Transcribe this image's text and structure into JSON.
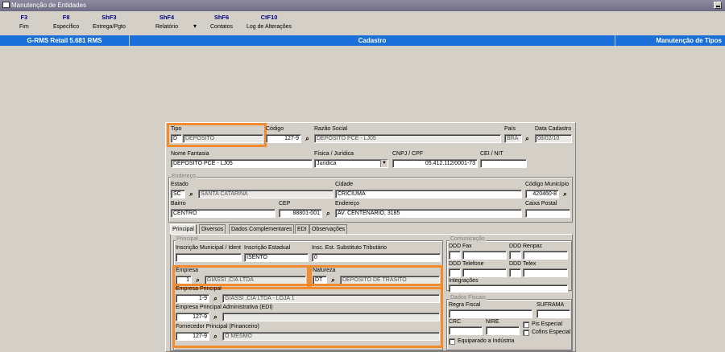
{
  "window": {
    "title": "Manutenção de Entidades"
  },
  "fkeys": [
    {
      "key": "F3",
      "label": "Fim"
    },
    {
      "key": "F8",
      "label": "Específico"
    },
    {
      "key": "ShF3",
      "label": "Entrega/Pgto"
    },
    {
      "key": "ShF4",
      "label": "Relatório"
    },
    {
      "key": "ShF6",
      "label": "Contatos"
    },
    {
      "key": "CtF10",
      "label": "Log de Alterações"
    }
  ],
  "fkey_more": "▾",
  "header": {
    "left": "G-RMS Retail 5.681 RMS",
    "center": "Cadastro",
    "right": "Manutenção de Tipos"
  },
  "top": {
    "tipo_label": "Tipo",
    "tipo_code": "D",
    "tipo_desc": "DEPOSITO",
    "codigo_label": "Código",
    "codigo_value": "127-9",
    "razao_label": "Razão Social",
    "razao_value": "DEPOSITO PCE - LJ05",
    "pais_label": "País",
    "pais_value": "BRA",
    "data_label": "Data Cadastro",
    "data_value": "08/02/10",
    "fantasia_label": "Nome Fantasia",
    "fantasia_value": "DEPOSITO PCE - LJ05",
    "fisica_label": "Física / Jurídica",
    "fisica_value": "Jurídica",
    "cnpj_label": "CNPJ / CPF",
    "cnpj_value": "05.412.112/0001-73",
    "cei_label": "CEI / NIT",
    "cei_value": ""
  },
  "endereco": {
    "group_title": "Endereço",
    "estado_label": "Estado",
    "estado_uf": "SC",
    "estado_nome": "SANTA CATARINA",
    "cidade_label": "Cidade",
    "cidade_value": "CRICIUMA",
    "municipio_label": "Código Município",
    "municipio_value": "420460-8",
    "bairro_label": "Bairro",
    "bairro_value": "CENTRO",
    "cep_label": "CEP",
    "cep_value": "88801-001",
    "endereco_label": "Endereço",
    "endereco_value": "AV. CENTENARIO, 3185",
    "caixa_label": "Caixa Postal",
    "caixa_value": ""
  },
  "tabs": [
    "Principal",
    "Diversos",
    "Dados Complementares",
    "EDI",
    "Observações"
  ],
  "principal": {
    "group_title": "Principal",
    "insc_mun_label": "Inscrição Municipal / Ident",
    "insc_mun_value": "",
    "insc_est_label": "Inscrição Estadual",
    "insc_est_value": "ISENTO",
    "insc_sub_label": "Insc. Est. Substituto Tributário",
    "insc_sub_value": "0",
    "empresa_label": "Empresa",
    "empresa_code": "1",
    "empresa_desc": "GIASSI ,CIA LTDA",
    "natureza_label": "Natureza",
    "natureza_code": "DT",
    "natureza_desc": "DEPOSITO DE TRASITO",
    "emp_principal_label": "Empresa Principal",
    "emp_principal_code": "1-9",
    "emp_principal_desc": "GIASSI ,CIA LTDA - LOJA 1",
    "emp_edi_label": "Empresa Principal Administrativa (EDI)",
    "emp_edi_code": "127-9",
    "emp_edi_desc": "",
    "fornec_label": "Fornecedor Principal (Financeiro)",
    "fornec_code": "127-9",
    "fornec_desc": "O MESMO"
  },
  "comunicacao": {
    "group_title": "Comunicação",
    "ddd1_label": "DDD",
    "fax_label": "Fax",
    "ddd2_label": "DDD",
    "renpac_label": "Renpac",
    "ddd3_label": "DDD",
    "telefone_label": "Telefone",
    "ddd4_label": "DDD",
    "telex_label": "Telex",
    "integracoes_label": "Integrações"
  },
  "fiscais": {
    "group_title": "Dados Fiscais",
    "regra_label": "Regra Fiscal",
    "suframa_label": "SUFRAMA",
    "crc_label": "CRC",
    "nire_label": "NIRE",
    "pis_label": "Pis Especial",
    "cofins_label": "Cofins Especial",
    "equiparado_label": "Equiparado a Indústria"
  },
  "colors": {
    "header": "#1a6fd8",
    "highlight": "#f28a2e",
    "window_bg": "#d4d0c8"
  },
  "icons": {
    "lookup": "binoculars-icon"
  }
}
